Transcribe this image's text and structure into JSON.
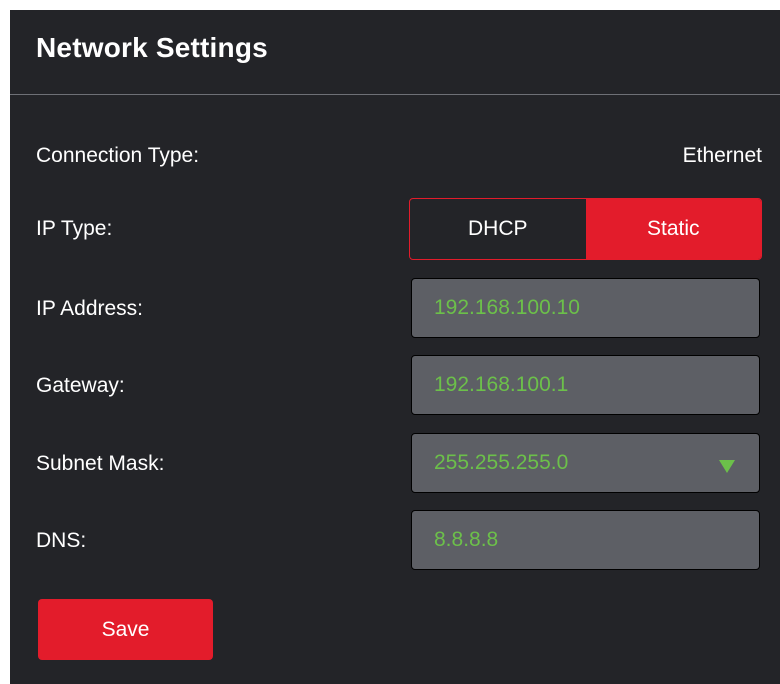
{
  "header": {
    "title": "Network Settings"
  },
  "connection_type": {
    "label": "Connection Type:",
    "value": "Ethernet"
  },
  "ip_type": {
    "label": "IP Type:",
    "options": [
      "DHCP",
      "Static"
    ],
    "selected": "Static"
  },
  "ip_address": {
    "label": "IP Address:",
    "value": "192.168.100.10"
  },
  "gateway": {
    "label": "Gateway:",
    "value": "192.168.100.1"
  },
  "subnet_mask": {
    "label": "Subnet Mask:",
    "value": "255.255.255.0",
    "icon": "chevron-down-icon"
  },
  "dns": {
    "label": "DNS:",
    "value": "8.8.8.8"
  },
  "actions": {
    "save_label": "Save"
  },
  "colors": {
    "panel_bg": "#232428",
    "accent_red": "#e31c2b",
    "field_bg": "#5d5f65",
    "value_green": "#6cc04a"
  }
}
